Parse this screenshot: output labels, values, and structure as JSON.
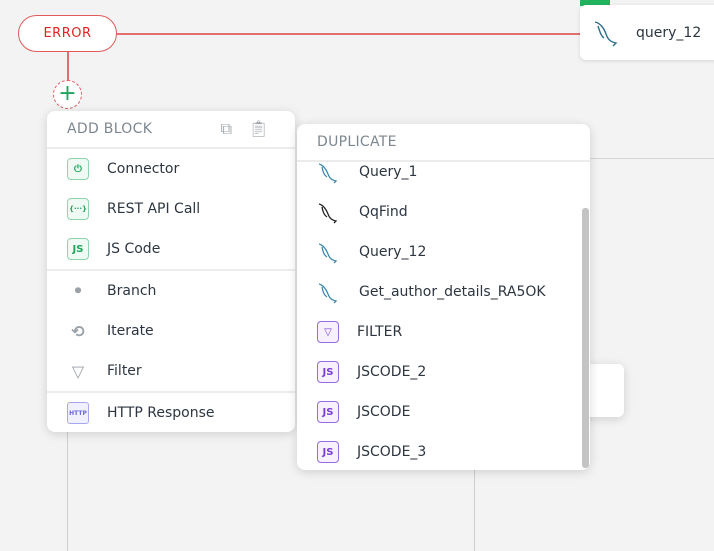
{
  "canvas": {
    "error_node": {
      "label": "ERROR"
    },
    "add_button": {
      "label": "+"
    },
    "query_node": {
      "label": "query_12",
      "icon": "mysql-dolphin-icon"
    },
    "colors": {
      "error": "#e02424",
      "success": "#22a45d",
      "js_purple": "#7b3fd6"
    }
  },
  "add_block": {
    "title": "ADD BLOCK",
    "groups": [
      [
        {
          "label": "Connector",
          "icon": "plug-icon"
        },
        {
          "label": "REST API Call",
          "icon": "braces-icon",
          "glyph": "{···}"
        },
        {
          "label": "JS Code",
          "icon": "js-icon",
          "glyph": "JS"
        }
      ],
      [
        {
          "label": "Branch",
          "icon": "branch-icon",
          "glyph": "⊥"
        },
        {
          "label": "Iterate",
          "icon": "iterate-icon",
          "glyph": "⟲"
        },
        {
          "label": "Filter",
          "icon": "filter-icon",
          "glyph": "▽"
        }
      ],
      [
        {
          "label": "HTTP Response",
          "icon": "http-response-icon",
          "glyph": "HTTP"
        }
      ]
    ]
  },
  "duplicate": {
    "title": "DUPLICATE",
    "items": [
      {
        "label": "Query_1",
        "icon": "mysql-icon"
      },
      {
        "label": "QqFind",
        "icon": "mongodb-icon"
      },
      {
        "label": "Query_12",
        "icon": "mysql-icon"
      },
      {
        "label": "Get_author_details_RA5OK",
        "icon": "mysql-icon"
      },
      {
        "label": "FILTER",
        "icon": "filter-icon",
        "glyph": "▽"
      },
      {
        "label": "JSCODE_2",
        "icon": "js-icon",
        "glyph": "JS"
      },
      {
        "label": "JSCODE",
        "icon": "js-icon",
        "glyph": "JS"
      },
      {
        "label": "JSCODE_3",
        "icon": "js-icon",
        "glyph": "JS"
      }
    ]
  }
}
